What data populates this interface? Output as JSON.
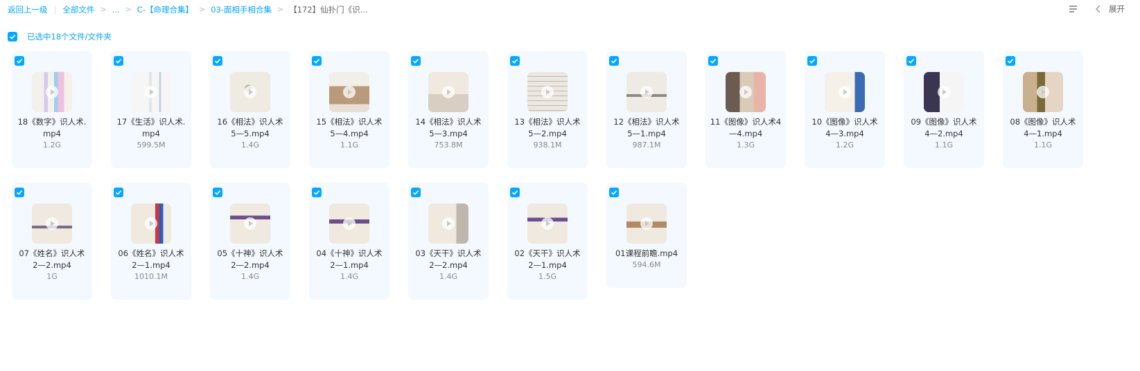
{
  "breadcrumb": {
    "back": "返回上一级",
    "root": "全部文件",
    "ellipsis": "...",
    "level1": "C-【命理合集】",
    "level2": "03-面相手相合集",
    "current": "【172】仙扑门《识..."
  },
  "toolbar": {
    "expand_label": "展开"
  },
  "selection": {
    "text": "已选中18个文件/文件夹"
  },
  "colors": {
    "accent": "#06a7ff",
    "card_bg": "#f3f9fe"
  },
  "files": [
    {
      "name": "18《数字》识人术.\nmp4",
      "size": "1.2G"
    },
    {
      "name": "17《生活》识人术.\nmp4",
      "size": "599.5M"
    },
    {
      "name": "16《相法》识人术\n5—5.mp4",
      "size": "1.4G"
    },
    {
      "name": "15《相法》识人术\n5—4.mp4",
      "size": "1.1G"
    },
    {
      "name": "14《相法》识人术\n5—3.mp4",
      "size": "753.8M"
    },
    {
      "name": "13《相法》识人术\n5—2.mp4",
      "size": "938.1M"
    },
    {
      "name": "12《相法》识人术\n5—1.mp4",
      "size": "987.1M"
    },
    {
      "name": "11《图像》识人术4\n—4.mp4",
      "size": "1.3G"
    },
    {
      "name": "10《图像》识人术\n4—3.mp4",
      "size": "1.2G"
    },
    {
      "name": "09《图像》识人术\n4—2.mp4",
      "size": "1.1G"
    },
    {
      "name": "08《图像》识人术\n4—1.mp4",
      "size": "1.1G"
    },
    {
      "name": "07《姓名》识人术\n2—2.mp4",
      "size": "1G"
    },
    {
      "name": "06《姓名》识人术\n2—1.mp4",
      "size": "1010.1M"
    },
    {
      "name": "05《十神》识人术\n2—2.mp4",
      "size": "1.4G"
    },
    {
      "name": "04《十神》识人术\n2—1.mp4",
      "size": "1.4G"
    },
    {
      "name": "03《天干》识人术\n2—2.mp4",
      "size": "1.4G"
    },
    {
      "name": "02《天干》识人术\n2—1.mp4",
      "size": "1.5G"
    },
    {
      "name": "01课程前瞻.mp4",
      "size": "594.6M"
    }
  ]
}
